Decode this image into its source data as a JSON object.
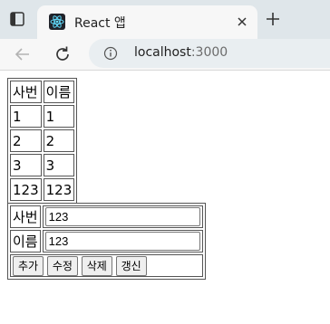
{
  "browser": {
    "tab_title": "React 앱",
    "url_host": "localhost",
    "url_port": ":3000"
  },
  "list": {
    "headers": [
      "사번",
      "이름"
    ],
    "rows": [
      [
        "1",
        "1"
      ],
      [
        "2",
        "2"
      ],
      [
        "3",
        "3"
      ],
      [
        "123",
        "123"
      ]
    ]
  },
  "form": {
    "id_label": "사번",
    "id_value": "123",
    "name_label": "이름",
    "name_value": "123",
    "buttons": {
      "add": "추가",
      "edit": "수정",
      "delete": "삭제",
      "refresh": "갱신"
    }
  }
}
